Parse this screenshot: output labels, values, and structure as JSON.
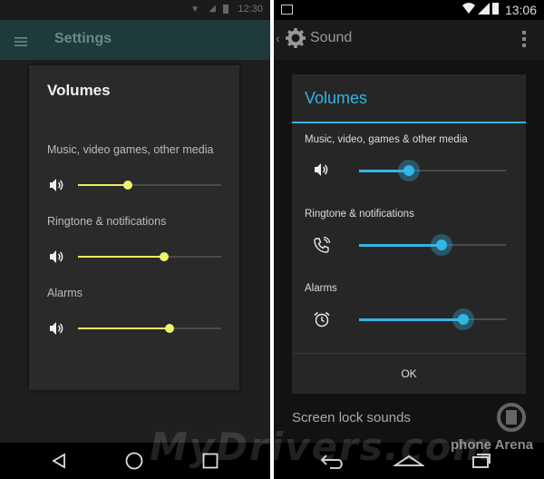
{
  "left": {
    "status_time": "12:30",
    "appbar_title": "Settings",
    "dialog_title": "Volumes",
    "sliders": [
      {
        "label": "Music, video games, other media",
        "icon": "speaker-icon",
        "level": 0.35
      },
      {
        "label": "Ringtone & notifications",
        "icon": "speaker-icon",
        "level": 0.6
      },
      {
        "label": "Alarms",
        "icon": "speaker-icon",
        "level": 0.64
      }
    ],
    "accent": "#eef56a"
  },
  "right": {
    "status_time": "13:06",
    "appbar_title": "Sound",
    "dialog_title": "Volumes",
    "sliders": [
      {
        "label": "Music, video, games & other media",
        "icon": "speaker-icon",
        "level": 0.34
      },
      {
        "label": "Ringtone & notifications",
        "icon": "ringtone-icon",
        "level": 0.56
      },
      {
        "label": "Alarms",
        "icon": "alarm-clock-icon",
        "level": 0.71
      }
    ],
    "ok_label": "OK",
    "background_item": "Screen lock sounds",
    "accent": "#33b5e5"
  },
  "watermark": "MyDrivers.com",
  "watermark2": "phone Arena"
}
